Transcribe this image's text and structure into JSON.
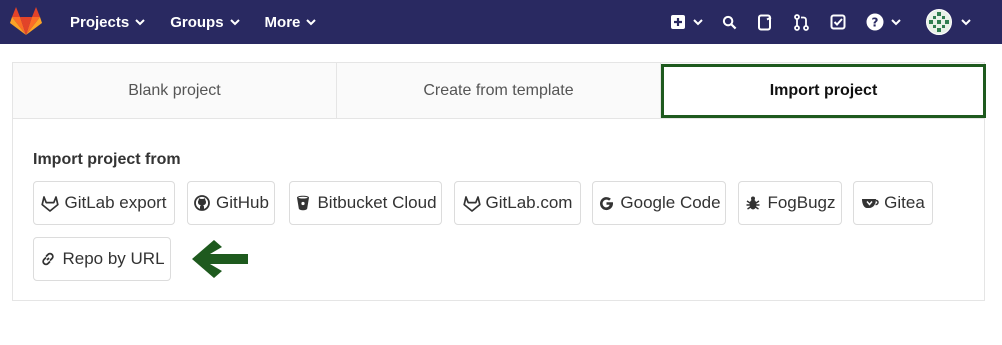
{
  "navbar": {
    "items": [
      {
        "label": "Projects"
      },
      {
        "label": "Groups"
      },
      {
        "label": "More"
      }
    ],
    "icons": [
      "plus-square-icon",
      "search-icon",
      "issues-icon",
      "merge-requests-icon",
      "todos-icon",
      "help-icon",
      "avatar-icon"
    ],
    "colors": {
      "background": "#292961",
      "logo_orange": "#e24329"
    }
  },
  "tabs": [
    {
      "label": "Blank project"
    },
    {
      "label": "Create from template"
    },
    {
      "label": "Import project",
      "active": true
    }
  ],
  "import": {
    "heading": "Import project from",
    "sources": [
      {
        "label": "GitLab export",
        "icon": "gitlab-icon"
      },
      {
        "label": "GitHub",
        "icon": "github-icon"
      },
      {
        "label": "Bitbucket Cloud",
        "icon": "bitbucket-icon"
      },
      {
        "label": "GitLab.com",
        "icon": "gitlab-icon"
      },
      {
        "label": "Google Code",
        "icon": "google-icon"
      },
      {
        "label": "FogBugz",
        "icon": "bug-icon"
      },
      {
        "label": "Gitea",
        "icon": "gitea-icon"
      },
      {
        "label": "Repo by URL",
        "icon": "link-icon"
      }
    ]
  },
  "annotation": {
    "arrow_color": "#1e5a1e"
  }
}
